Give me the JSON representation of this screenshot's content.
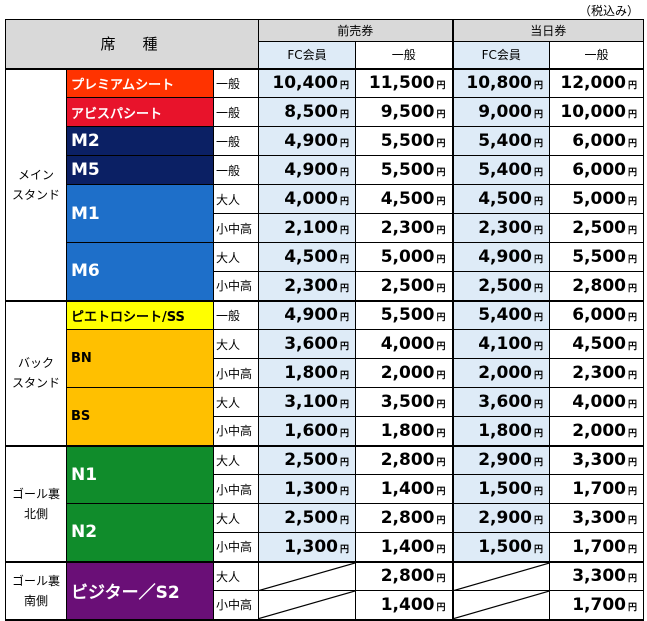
{
  "tax_note": "（税込み）",
  "header": {
    "seat_type": "席　種",
    "advance": "前売券",
    "same_day": "当日券",
    "fc_member": "FC会員",
    "general": "一般"
  },
  "yen": "円",
  "colors": {
    "premium": "#ff3300",
    "avispa": "#e8132b",
    "m2": "#0b2064",
    "m5": "#0b2064",
    "m1": "#1e6fc9",
    "m6": "#1e6fc9",
    "pietro": "#ffff00",
    "bn": "#ffc000",
    "bs": "#ffc000",
    "n1": "#108c2b",
    "n2": "#108c2b",
    "visitor": "#6a0f77",
    "header_bg": "#d9d9d9",
    "fc_bg": "#deebf7"
  },
  "areas": {
    "main": "メイン\nスタンド",
    "back": "バック\nスタンド",
    "goal_north": "ゴール裏\n北側",
    "goal_south": "ゴール裏\n南側"
  },
  "seats": {
    "premium": {
      "name": "プレミアムシート",
      "rows": [
        {
          "type": "一般",
          "adv_fc": "10,400",
          "adv_gen": "11,500",
          "day_fc": "10,800",
          "day_gen": "12,000"
        }
      ]
    },
    "avispa": {
      "name": "アビスパシート",
      "rows": [
        {
          "type": "一般",
          "adv_fc": "8,500",
          "adv_gen": "9,500",
          "day_fc": "9,000",
          "day_gen": "10,000"
        }
      ]
    },
    "m2": {
      "name": "M2",
      "rows": [
        {
          "type": "一般",
          "adv_fc": "4,900",
          "adv_gen": "5,500",
          "day_fc": "5,400",
          "day_gen": "6,000"
        }
      ]
    },
    "m5": {
      "name": "M5",
      "rows": [
        {
          "type": "一般",
          "adv_fc": "4,900",
          "adv_gen": "5,500",
          "day_fc": "5,400",
          "day_gen": "6,000"
        }
      ]
    },
    "m1": {
      "name": "M1",
      "rows": [
        {
          "type": "大人",
          "adv_fc": "4,000",
          "adv_gen": "4,500",
          "day_fc": "4,500",
          "day_gen": "5,000"
        },
        {
          "type": "小中高",
          "adv_fc": "2,100",
          "adv_gen": "2,300",
          "day_fc": "2,300",
          "day_gen": "2,500"
        }
      ]
    },
    "m6": {
      "name": "M6",
      "rows": [
        {
          "type": "大人",
          "adv_fc": "4,500",
          "adv_gen": "5,000",
          "day_fc": "4,900",
          "day_gen": "5,500"
        },
        {
          "type": "小中高",
          "adv_fc": "2,300",
          "adv_gen": "2,500",
          "day_fc": "2,500",
          "day_gen": "2,800"
        }
      ]
    },
    "pietro": {
      "name": "ピエトロシート/SS",
      "rows": [
        {
          "type": "一般",
          "adv_fc": "4,900",
          "adv_gen": "5,500",
          "day_fc": "5,400",
          "day_gen": "6,000"
        }
      ]
    },
    "bn": {
      "name": "BN",
      "rows": [
        {
          "type": "大人",
          "adv_fc": "3,600",
          "adv_gen": "4,000",
          "day_fc": "4,100",
          "day_gen": "4,500"
        },
        {
          "type": "小中高",
          "adv_fc": "1,800",
          "adv_gen": "2,000",
          "day_fc": "2,000",
          "day_gen": "2,300"
        }
      ]
    },
    "bs": {
      "name": "BS",
      "rows": [
        {
          "type": "大人",
          "adv_fc": "3,100",
          "adv_gen": "3,500",
          "day_fc": "3,600",
          "day_gen": "4,000"
        },
        {
          "type": "小中高",
          "adv_fc": "1,600",
          "adv_gen": "1,800",
          "day_fc": "1,800",
          "day_gen": "2,000"
        }
      ]
    },
    "n1": {
      "name": "N1",
      "rows": [
        {
          "type": "大人",
          "adv_fc": "2,500",
          "adv_gen": "2,800",
          "day_fc": "2,900",
          "day_gen": "3,300"
        },
        {
          "type": "小中高",
          "adv_fc": "1,300",
          "adv_gen": "1,400",
          "day_fc": "1,500",
          "day_gen": "1,700"
        }
      ]
    },
    "n2": {
      "name": "N2",
      "rows": [
        {
          "type": "大人",
          "adv_fc": "2,500",
          "adv_gen": "2,800",
          "day_fc": "2,900",
          "day_gen": "3,300"
        },
        {
          "type": "小中高",
          "adv_fc": "1,300",
          "adv_gen": "1,400",
          "day_fc": "1,500",
          "day_gen": "1,700"
        }
      ]
    },
    "visitor": {
      "name": "ビジター／S2",
      "rows": [
        {
          "type": "大人",
          "adv_gen": "2,800",
          "day_gen": "3,300"
        },
        {
          "type": "小中高",
          "adv_gen": "1,400",
          "day_gen": "1,700"
        }
      ]
    }
  }
}
